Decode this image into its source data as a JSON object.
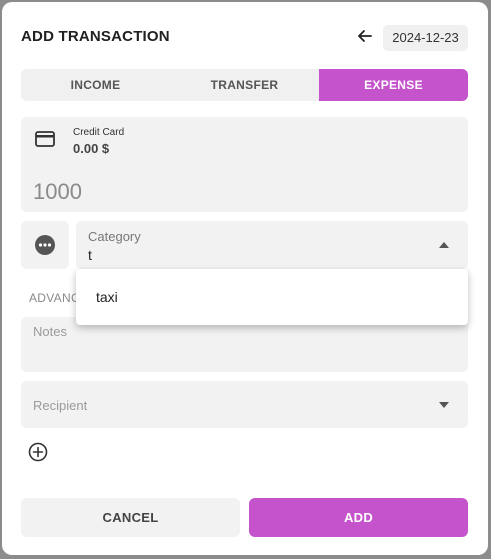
{
  "dialog": {
    "title": "ADD TRANSACTION",
    "date": "2024-12-23"
  },
  "tabs": [
    {
      "label": "INCOME",
      "active": false
    },
    {
      "label": "TRANSFER",
      "active": false
    },
    {
      "label": "EXPENSE",
      "active": true
    }
  ],
  "account": {
    "name": "Credit Card",
    "balance": "0.00 $",
    "amount": "1000"
  },
  "category": {
    "label": "Category",
    "value": "t",
    "options": [
      "taxi"
    ]
  },
  "advanced_label": "ADVANCED",
  "notes": {
    "placeholder": "Notes"
  },
  "recipient": {
    "placeholder": "Recipient"
  },
  "buttons": {
    "cancel": "CANCEL",
    "add": "ADD"
  },
  "colors": {
    "accent": "#c453cc",
    "field_bg": "#f2f2f2",
    "backdrop": "#8c8c8c"
  },
  "icons": [
    "back-arrow-icon",
    "credit-card-icon",
    "more-horiz-icon",
    "caret-up-icon",
    "caret-down-icon",
    "add-circle-icon"
  ]
}
